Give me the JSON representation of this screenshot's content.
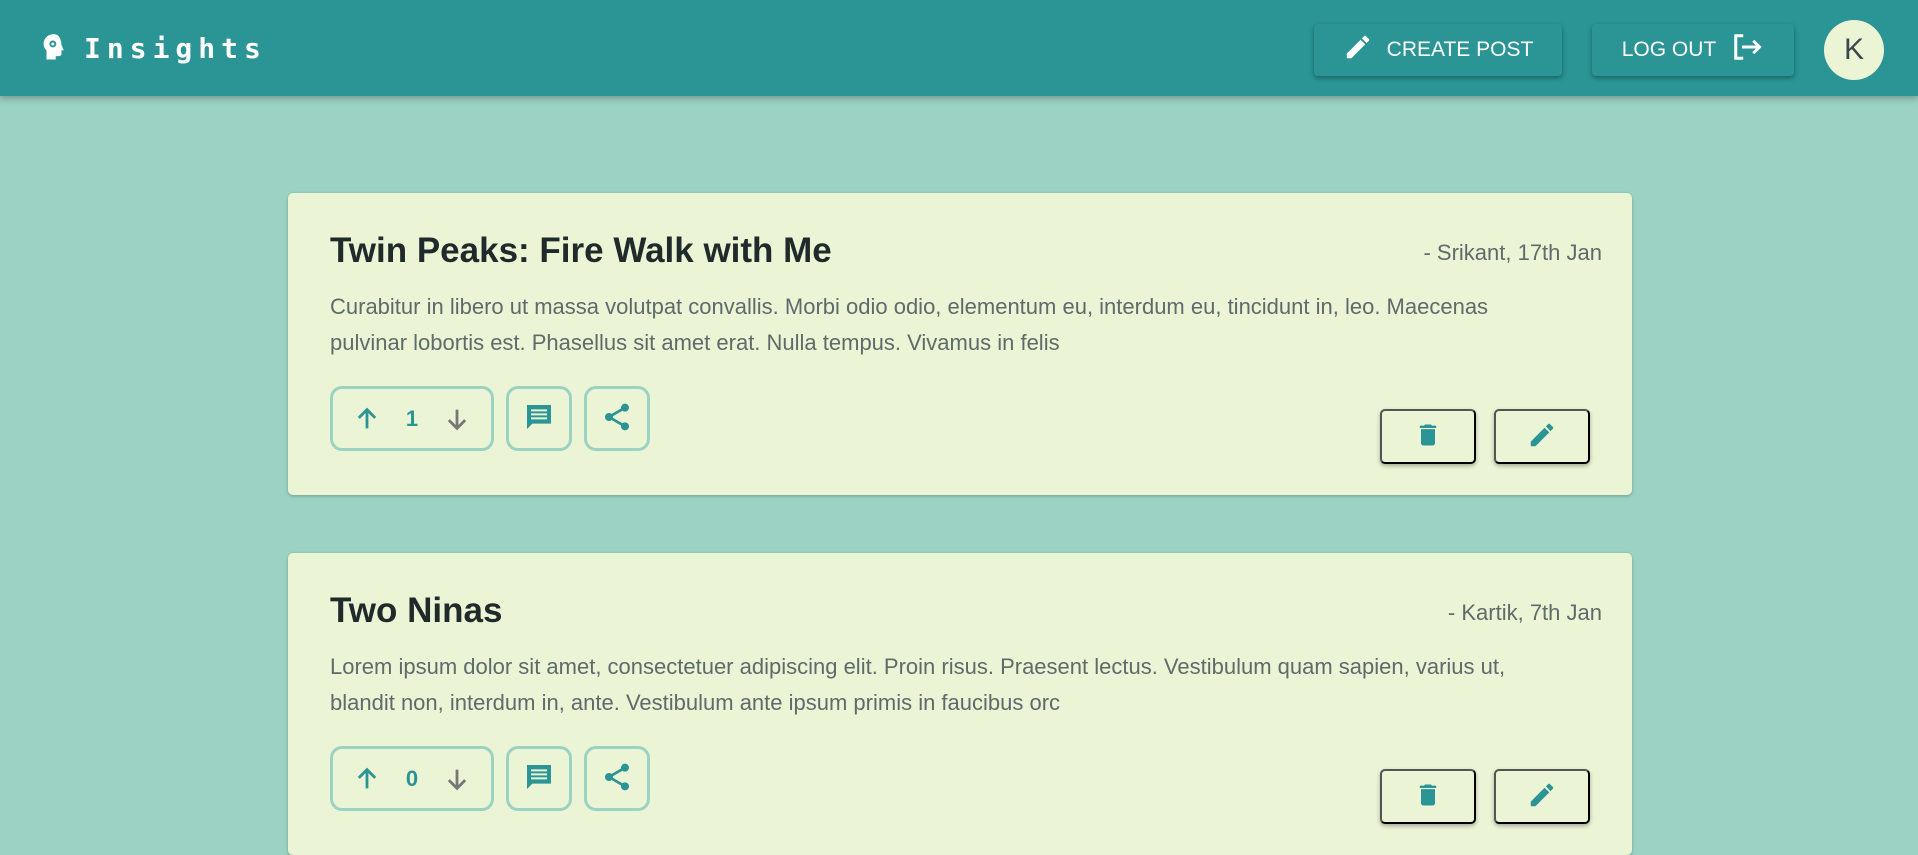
{
  "app": {
    "brand": "Insights",
    "create_post_label": "CREATE POST",
    "logout_label": "LOG OUT",
    "avatar_initial": "K"
  },
  "colors": {
    "primary": "#2b9494",
    "background": "#9cd2c3",
    "card": "#ecf4d6"
  },
  "posts": [
    {
      "title": "Twin Peaks: Fire Walk with Me",
      "meta": "- Srikant, 17th Jan",
      "body": "Curabitur in libero ut massa volutpat convallis. Morbi odio odio, elementum eu, interdum eu, tincidunt in, leo. Maecenas pulvinar lobortis est. Phasellus sit amet erat. Nulla tempus. Vivamus in felis",
      "votes": "1"
    },
    {
      "title": "Two Ninas",
      "meta": "- Kartik, 7th Jan",
      "body": "Lorem ipsum dolor sit amet, consectetuer adipiscing elit. Proin risus. Praesent lectus. Vestibulum quam sapien, varius ut, blandit non, interdum in, ante. Vestibulum ante ipsum primis in faucibus orc",
      "votes": "0"
    }
  ],
  "icons": [
    "brain-icon",
    "pencil-icon",
    "logout-icon",
    "arrow-up-icon",
    "arrow-down-icon",
    "comment-icon",
    "share-icon",
    "trash-icon",
    "edit-icon"
  ]
}
